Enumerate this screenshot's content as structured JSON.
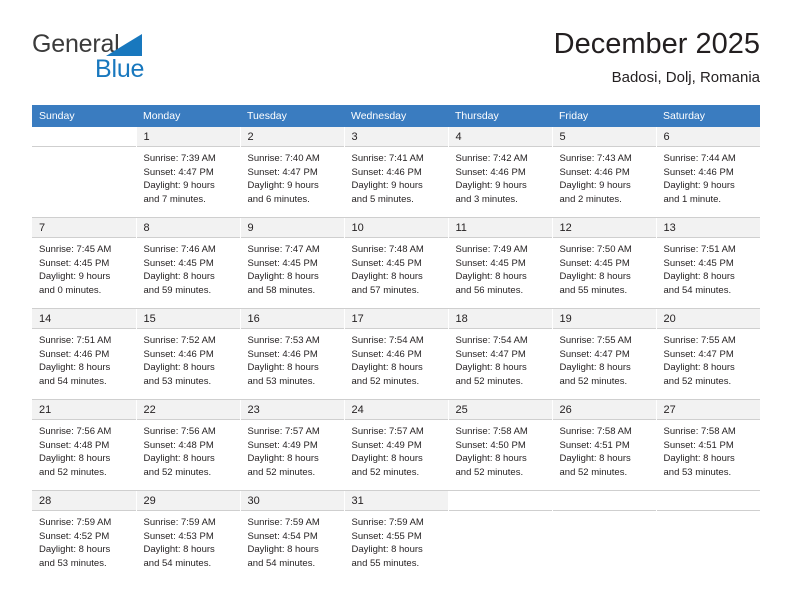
{
  "brand": {
    "name_part1": "General",
    "name_part2": "Blue",
    "triangle_color": "#1878be"
  },
  "header": {
    "title": "December 2025",
    "subtitle": "Badosi, Dolj, Romania",
    "header_bg": "#3a7cc0",
    "daynum_bg": "#f2f2f2"
  },
  "weekday_headers": [
    "Sunday",
    "Monday",
    "Tuesday",
    "Wednesday",
    "Thursday",
    "Friday",
    "Saturday"
  ],
  "labels": {
    "sunrise_prefix": "Sunrise:",
    "sunset_prefix": "Sunset:",
    "daylight_prefix": "Daylight:"
  },
  "weeks": [
    [
      {
        "day": "",
        "lines": [
          "",
          "",
          "",
          ""
        ]
      },
      {
        "day": "1",
        "lines": [
          "Sunrise: 7:39 AM",
          "Sunset: 4:47 PM",
          "Daylight: 9 hours",
          "and 7 minutes."
        ]
      },
      {
        "day": "2",
        "lines": [
          "Sunrise: 7:40 AM",
          "Sunset: 4:47 PM",
          "Daylight: 9 hours",
          "and 6 minutes."
        ]
      },
      {
        "day": "3",
        "lines": [
          "Sunrise: 7:41 AM",
          "Sunset: 4:46 PM",
          "Daylight: 9 hours",
          "and 5 minutes."
        ]
      },
      {
        "day": "4",
        "lines": [
          "Sunrise: 7:42 AM",
          "Sunset: 4:46 PM",
          "Daylight: 9 hours",
          "and 3 minutes."
        ]
      },
      {
        "day": "5",
        "lines": [
          "Sunrise: 7:43 AM",
          "Sunset: 4:46 PM",
          "Daylight: 9 hours",
          "and 2 minutes."
        ]
      },
      {
        "day": "6",
        "lines": [
          "Sunrise: 7:44 AM",
          "Sunset: 4:46 PM",
          "Daylight: 9 hours",
          "and 1 minute."
        ]
      }
    ],
    [
      {
        "day": "7",
        "lines": [
          "Sunrise: 7:45 AM",
          "Sunset: 4:45 PM",
          "Daylight: 9 hours",
          "and 0 minutes."
        ]
      },
      {
        "day": "8",
        "lines": [
          "Sunrise: 7:46 AM",
          "Sunset: 4:45 PM",
          "Daylight: 8 hours",
          "and 59 minutes."
        ]
      },
      {
        "day": "9",
        "lines": [
          "Sunrise: 7:47 AM",
          "Sunset: 4:45 PM",
          "Daylight: 8 hours",
          "and 58 minutes."
        ]
      },
      {
        "day": "10",
        "lines": [
          "Sunrise: 7:48 AM",
          "Sunset: 4:45 PM",
          "Daylight: 8 hours",
          "and 57 minutes."
        ]
      },
      {
        "day": "11",
        "lines": [
          "Sunrise: 7:49 AM",
          "Sunset: 4:45 PM",
          "Daylight: 8 hours",
          "and 56 minutes."
        ]
      },
      {
        "day": "12",
        "lines": [
          "Sunrise: 7:50 AM",
          "Sunset: 4:45 PM",
          "Daylight: 8 hours",
          "and 55 minutes."
        ]
      },
      {
        "day": "13",
        "lines": [
          "Sunrise: 7:51 AM",
          "Sunset: 4:45 PM",
          "Daylight: 8 hours",
          "and 54 minutes."
        ]
      }
    ],
    [
      {
        "day": "14",
        "lines": [
          "Sunrise: 7:51 AM",
          "Sunset: 4:46 PM",
          "Daylight: 8 hours",
          "and 54 minutes."
        ]
      },
      {
        "day": "15",
        "lines": [
          "Sunrise: 7:52 AM",
          "Sunset: 4:46 PM",
          "Daylight: 8 hours",
          "and 53 minutes."
        ]
      },
      {
        "day": "16",
        "lines": [
          "Sunrise: 7:53 AM",
          "Sunset: 4:46 PM",
          "Daylight: 8 hours",
          "and 53 minutes."
        ]
      },
      {
        "day": "17",
        "lines": [
          "Sunrise: 7:54 AM",
          "Sunset: 4:46 PM",
          "Daylight: 8 hours",
          "and 52 minutes."
        ]
      },
      {
        "day": "18",
        "lines": [
          "Sunrise: 7:54 AM",
          "Sunset: 4:47 PM",
          "Daylight: 8 hours",
          "and 52 minutes."
        ]
      },
      {
        "day": "19",
        "lines": [
          "Sunrise: 7:55 AM",
          "Sunset: 4:47 PM",
          "Daylight: 8 hours",
          "and 52 minutes."
        ]
      },
      {
        "day": "20",
        "lines": [
          "Sunrise: 7:55 AM",
          "Sunset: 4:47 PM",
          "Daylight: 8 hours",
          "and 52 minutes."
        ]
      }
    ],
    [
      {
        "day": "21",
        "lines": [
          "Sunrise: 7:56 AM",
          "Sunset: 4:48 PM",
          "Daylight: 8 hours",
          "and 52 minutes."
        ]
      },
      {
        "day": "22",
        "lines": [
          "Sunrise: 7:56 AM",
          "Sunset: 4:48 PM",
          "Daylight: 8 hours",
          "and 52 minutes."
        ]
      },
      {
        "day": "23",
        "lines": [
          "Sunrise: 7:57 AM",
          "Sunset: 4:49 PM",
          "Daylight: 8 hours",
          "and 52 minutes."
        ]
      },
      {
        "day": "24",
        "lines": [
          "Sunrise: 7:57 AM",
          "Sunset: 4:49 PM",
          "Daylight: 8 hours",
          "and 52 minutes."
        ]
      },
      {
        "day": "25",
        "lines": [
          "Sunrise: 7:58 AM",
          "Sunset: 4:50 PM",
          "Daylight: 8 hours",
          "and 52 minutes."
        ]
      },
      {
        "day": "26",
        "lines": [
          "Sunrise: 7:58 AM",
          "Sunset: 4:51 PM",
          "Daylight: 8 hours",
          "and 52 minutes."
        ]
      },
      {
        "day": "27",
        "lines": [
          "Sunrise: 7:58 AM",
          "Sunset: 4:51 PM",
          "Daylight: 8 hours",
          "and 53 minutes."
        ]
      }
    ],
    [
      {
        "day": "28",
        "lines": [
          "Sunrise: 7:59 AM",
          "Sunset: 4:52 PM",
          "Daylight: 8 hours",
          "and 53 minutes."
        ]
      },
      {
        "day": "29",
        "lines": [
          "Sunrise: 7:59 AM",
          "Sunset: 4:53 PM",
          "Daylight: 8 hours",
          "and 54 minutes."
        ]
      },
      {
        "day": "30",
        "lines": [
          "Sunrise: 7:59 AM",
          "Sunset: 4:54 PM",
          "Daylight: 8 hours",
          "and 54 minutes."
        ]
      },
      {
        "day": "31",
        "lines": [
          "Sunrise: 7:59 AM",
          "Sunset: 4:55 PM",
          "Daylight: 8 hours",
          "and 55 minutes."
        ]
      },
      {
        "day": "",
        "lines": [
          "",
          "",
          "",
          ""
        ]
      },
      {
        "day": "",
        "lines": [
          "",
          "",
          "",
          ""
        ]
      },
      {
        "day": "",
        "lines": [
          "",
          "",
          "",
          ""
        ]
      }
    ]
  ]
}
